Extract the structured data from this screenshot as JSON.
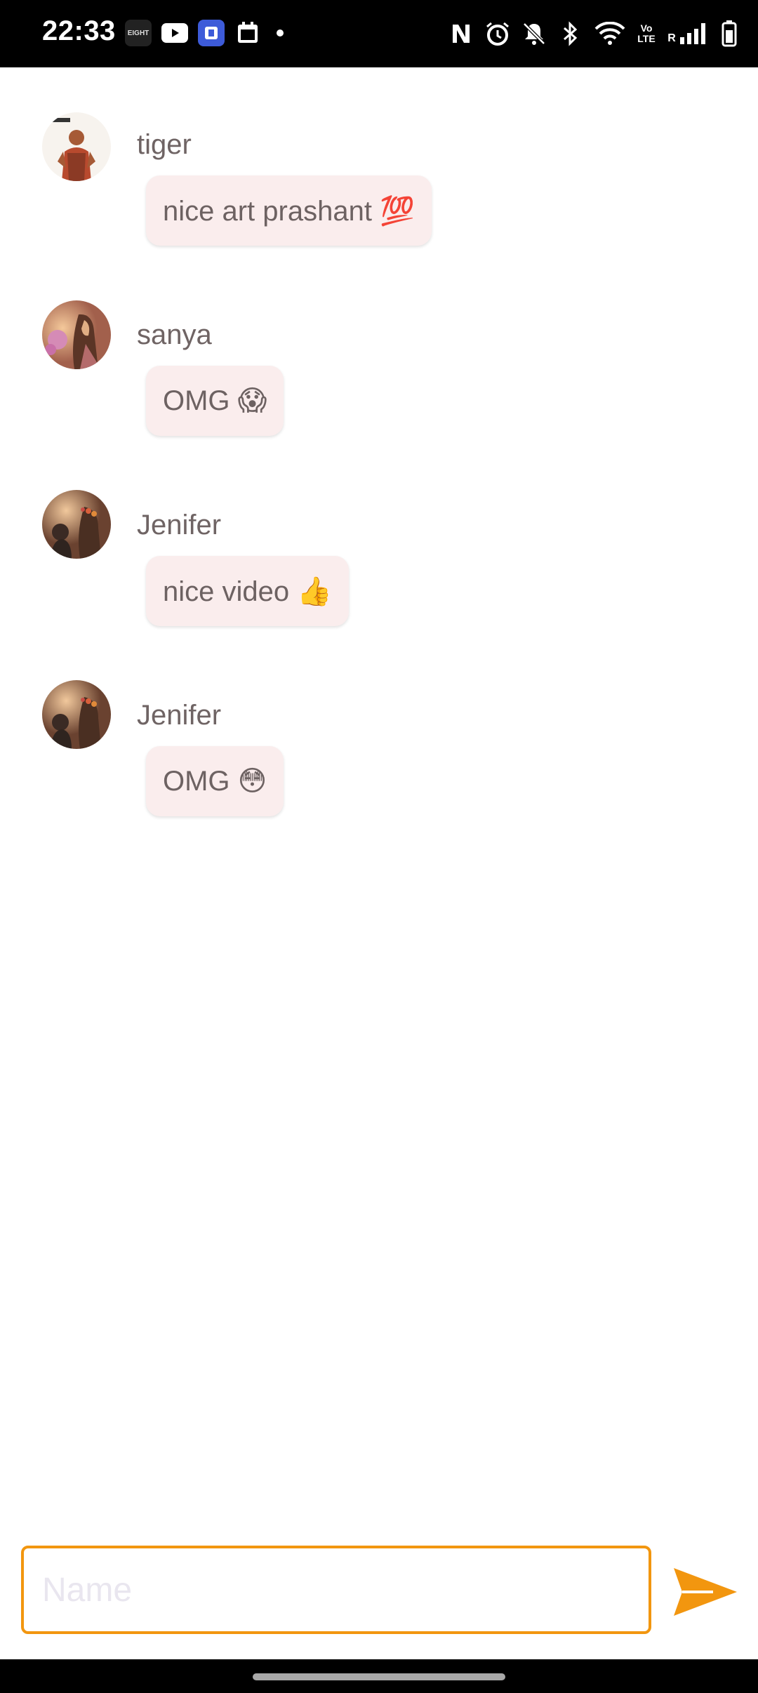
{
  "status_bar": {
    "time": "22:33",
    "app_icons": [
      "eight-app-icon",
      "youtube-icon",
      "bank-app-icon",
      "calendar-app-icon",
      "dot-icon"
    ],
    "system_icons": [
      "nfc-icon",
      "alarm-icon",
      "bell-off-icon",
      "bluetooth-icon",
      "wifi-icon",
      "volte-icon",
      "signal-icon",
      "battery-icon"
    ],
    "eight_label": "EIGHT",
    "volte_label": "Vo\nLTE",
    "roaming_label": "R"
  },
  "messages": [
    {
      "user": "tiger",
      "text": "nice art prashant 💯"
    },
    {
      "user": "sanya",
      "text": "OMG 😱"
    },
    {
      "user": "Jenifer",
      "text": "nice video 👍"
    },
    {
      "user": "Jenifer",
      "text": "OMG 😳"
    }
  ],
  "composer": {
    "placeholder": "Name",
    "value": ""
  },
  "colors": {
    "accent": "#f2960f",
    "bubble": "#faeded",
    "text": "#6d6262"
  }
}
